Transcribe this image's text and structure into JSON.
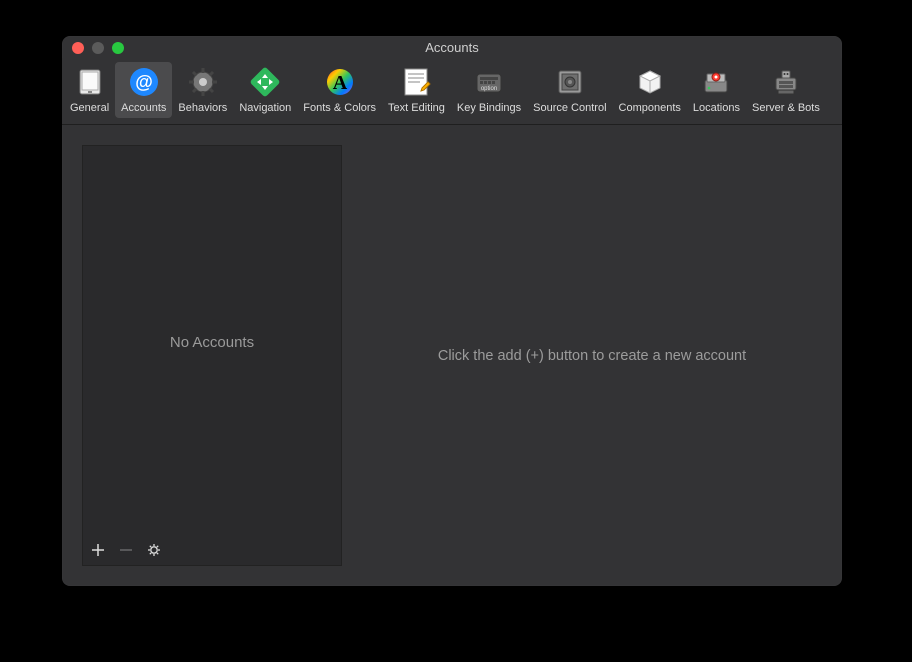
{
  "window": {
    "title": "Accounts"
  },
  "toolbar": {
    "tabs": [
      {
        "id": "general",
        "label": "General"
      },
      {
        "id": "accounts",
        "label": "Accounts",
        "selected": true
      },
      {
        "id": "behaviors",
        "label": "Behaviors"
      },
      {
        "id": "navigation",
        "label": "Navigation"
      },
      {
        "id": "fonts-colors",
        "label": "Fonts & Colors"
      },
      {
        "id": "text-editing",
        "label": "Text Editing"
      },
      {
        "id": "key-bindings",
        "label": "Key Bindings"
      },
      {
        "id": "source-control",
        "label": "Source Control"
      },
      {
        "id": "components",
        "label": "Components"
      },
      {
        "id": "locations",
        "label": "Locations"
      },
      {
        "id": "server-bots",
        "label": "Server & Bots"
      }
    ]
  },
  "sidebar": {
    "empty_text": "No Accounts",
    "footer": {
      "add_icon": "plus",
      "remove_icon": "minus",
      "actions_icon": "gear"
    }
  },
  "detail": {
    "empty_text": "Click the add (+) button to create a new account"
  }
}
